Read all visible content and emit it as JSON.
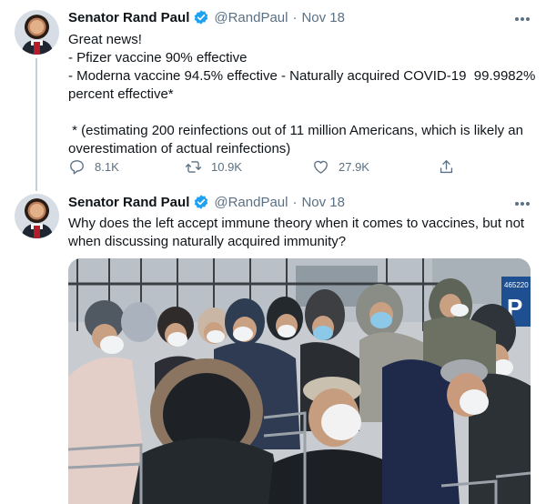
{
  "tweets": [
    {
      "name": "Senator Rand Paul",
      "handle": "@RandPaul",
      "separator": "·",
      "date": "Nov 18",
      "lines": [
        "Great news!",
        "- Pfizer vaccine 90% effective",
        "- Moderna vaccine 94.5% effective - Naturally acquired COVID-19  99.9982%",
        "percent effective*",
        "",
        " * (estimating 200 reinfections out of 11 million Americans, which is likely an",
        "overestimation of actual reinfections)"
      ],
      "replies": "8.1K",
      "retweets": "10.9K",
      "likes": "27.9K"
    },
    {
      "name": "Senator Rand Paul",
      "handle": "@RandPaul",
      "separator": "·",
      "date": "Nov 18",
      "lines": [
        "Why does the left accept immune theory when it comes to vaccines, but not",
        "when discussing naturally acquired immunity?"
      ],
      "image": {
        "sign_number": "465220",
        "sign_letter": "P"
      }
    }
  ],
  "colors": {
    "verified": "#1da1f2",
    "muted": "#5b7083",
    "text": "#0f1419"
  },
  "icons": [
    "verified-icon",
    "more-icon",
    "reply-icon",
    "retweet-icon",
    "like-icon",
    "share-icon"
  ]
}
